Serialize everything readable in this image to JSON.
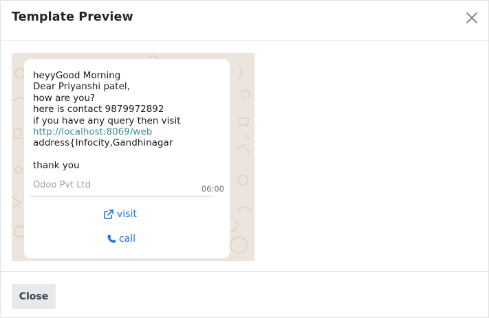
{
  "modal": {
    "title": "Template Preview",
    "close_button_label": "Close"
  },
  "message": {
    "lines": [
      "heyyGood Morning",
      "Dear Priyanshi patel,",
      "how are you?",
      "here is contact 9879972892",
      "if you have any query then visit"
    ],
    "link": "http://localhost:8069/web",
    "address": "address{Infocity,Gandhinagar",
    "closing": "thank you",
    "footer": "Odoo Pvt Ltd",
    "time": "06:00"
  },
  "buttons": {
    "visit_label": "visit",
    "call_label": "call"
  },
  "icons": {
    "close": "close-icon",
    "visit": "external-link-icon",
    "call": "phone-icon"
  },
  "colors": {
    "wallpaper": "#ece5dd",
    "link_text": "#3c8da0",
    "button_text": "#1f6fe0",
    "close_button_bg": "#e7e9ed"
  }
}
